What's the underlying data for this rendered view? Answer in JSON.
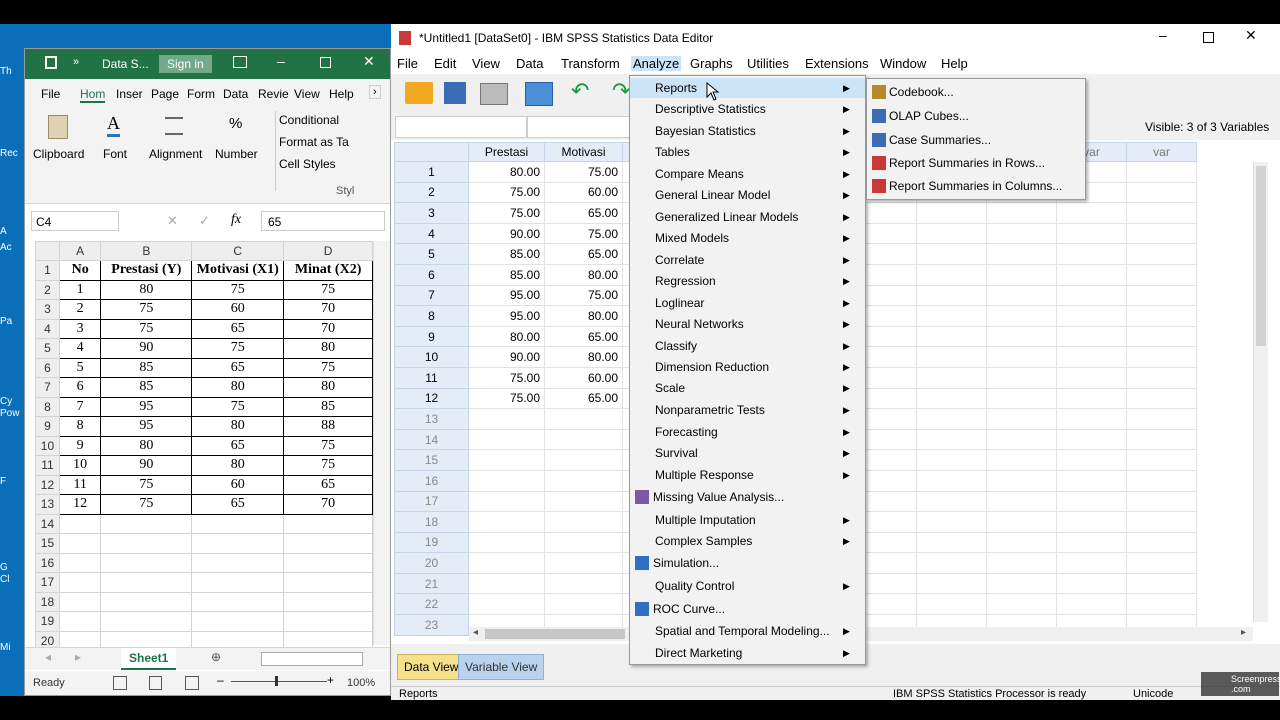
{
  "desktop": {
    "icons": [
      "Th",
      "Rec",
      "A",
      "Ac",
      "Pa",
      "Cy",
      "Pow",
      "F",
      "G",
      "Cl",
      "Mi"
    ]
  },
  "excel": {
    "title": "Data S...",
    "signin": "Sign in",
    "tabs": [
      "File",
      "Hom",
      "Inser",
      "Page",
      "Form",
      "Data",
      "Revie",
      "View",
      "Help"
    ],
    "ribbon": {
      "clipboard": "Clipboard",
      "font": "Font",
      "alignment": "Alignment",
      "number": "Number",
      "conditional": "Conditional",
      "format_as": "Format as Ta",
      "cell_styles": "Cell Styles",
      "styles": "Styl"
    },
    "name_box": "C4",
    "formula": "65",
    "columns": [
      "A",
      "B",
      "C",
      "D"
    ],
    "headers": [
      "No",
      "Prestasi (Y)",
      "Motivasi (X1)",
      "Minat (X2)"
    ],
    "rows": [
      [
        "1",
        "80",
        "75",
        "75"
      ],
      [
        "2",
        "75",
        "60",
        "70"
      ],
      [
        "3",
        "75",
        "65",
        "70"
      ],
      [
        "4",
        "90",
        "75",
        "80"
      ],
      [
        "5",
        "85",
        "65",
        "75"
      ],
      [
        "6",
        "85",
        "80",
        "80"
      ],
      [
        "7",
        "95",
        "75",
        "85"
      ],
      [
        "8",
        "95",
        "80",
        "88"
      ],
      [
        "9",
        "80",
        "65",
        "75"
      ],
      [
        "10",
        "90",
        "80",
        "75"
      ],
      [
        "11",
        "75",
        "60",
        "65"
      ],
      [
        "12",
        "75",
        "65",
        "70"
      ]
    ],
    "row_numbers": [
      "1",
      "2",
      "3",
      "4",
      "5",
      "6",
      "7",
      "8",
      "9",
      "10",
      "11",
      "12",
      "13",
      "14",
      "15",
      "16",
      "17",
      "18",
      "19",
      "20"
    ],
    "sheet_tab": "Sheet1",
    "status": "Ready",
    "zoom": "100%"
  },
  "spss": {
    "title": "*Untitled1 [DataSet0] - IBM SPSS Statistics Data Editor",
    "menu": [
      "File",
      "Edit",
      "View",
      "Data",
      "Transform",
      "Analyze",
      "Graphs",
      "Utilities",
      "Extensions",
      "Window",
      "Help"
    ],
    "visible": "Visible: 3 of 3 Variables",
    "columns": [
      "Prestasi",
      "Motivasi",
      "var",
      "var",
      "var"
    ],
    "prestasi": [
      "80.00",
      "75.00",
      "75.00",
      "90.00",
      "85.00",
      "85.00",
      "95.00",
      "95.00",
      "80.00",
      "90.00",
      "75.00",
      "75.00"
    ],
    "motivasi": [
      "75.00",
      "60.00",
      "65.00",
      "75.00",
      "65.00",
      "80.00",
      "75.00",
      "80.00",
      "65.00",
      "80.00",
      "60.00",
      "65.00"
    ],
    "row_numbers": [
      "1",
      "2",
      "3",
      "4",
      "5",
      "6",
      "7",
      "8",
      "9",
      "10",
      "11",
      "12",
      "13",
      "14",
      "15",
      "16",
      "17",
      "18",
      "19",
      "20",
      "21",
      "22",
      "23"
    ],
    "tabs": {
      "data_view": "Data View",
      "variable_view": "Variable View"
    },
    "status_left": "Reports",
    "status_mid": "IBM SPSS Statistics Processor is ready",
    "status_right": "Unicode"
  },
  "analyze_menu": [
    "Reports",
    "Descriptive Statistics",
    "Bayesian Statistics",
    "Tables",
    "Compare Means",
    "General Linear Model",
    "Generalized Linear Models",
    "Mixed Models",
    "Correlate",
    "Regression",
    "Loglinear",
    "Neural Networks",
    "Classify",
    "Dimension Reduction",
    "Scale",
    "Nonparametric Tests",
    "Forecasting",
    "Survival",
    "Multiple Response",
    "Missing Value Analysis...",
    "Multiple Imputation",
    "Complex Samples",
    "Simulation...",
    "Quality Control",
    "ROC Curve...",
    "Spatial and Temporal Modeling...",
    "Direct Marketing"
  ],
  "reports_submenu": [
    "Codebook...",
    "OLAP Cubes...",
    "Case Summaries...",
    "Report Summaries in Rows...",
    "Report Summaries in Columns..."
  ],
  "watermark": "Screenpresso\n.com"
}
